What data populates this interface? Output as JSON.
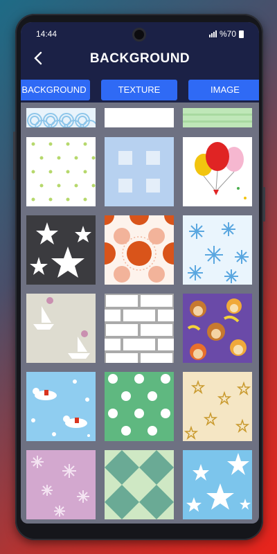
{
  "status_bar": {
    "time": "14:44",
    "battery": "%70"
  },
  "header": {
    "title": "BACKGROUND",
    "back_icon": "chevron-left-icon"
  },
  "tabs": [
    {
      "label": "BACKGROUND",
      "active": false
    },
    {
      "label": "TEXTURE",
      "active": true
    },
    {
      "label": "IMAGE",
      "active": false
    }
  ],
  "textures": [
    "blue-waves-pattern",
    "white-plain-pattern",
    "green-paper-pattern",
    "green-dots-pattern",
    "blue-gingham-pattern",
    "balloons-pattern",
    "dark-stars-pattern",
    "orange-circles-pattern",
    "blue-snowflakes-pattern",
    "sailboats-pattern",
    "white-bricks-pattern",
    "monkeys-pattern",
    "reindeer-snow-pattern",
    "green-polka-dots-pattern",
    "gold-stars-pattern",
    "pink-snowflakes-pattern",
    "green-diamonds-pattern",
    "blue-white-stars-pattern"
  ],
  "colors": {
    "header_bg": "#1b2146",
    "tab_bg": "#2f6af5",
    "grid_bg": "#6e7182"
  }
}
